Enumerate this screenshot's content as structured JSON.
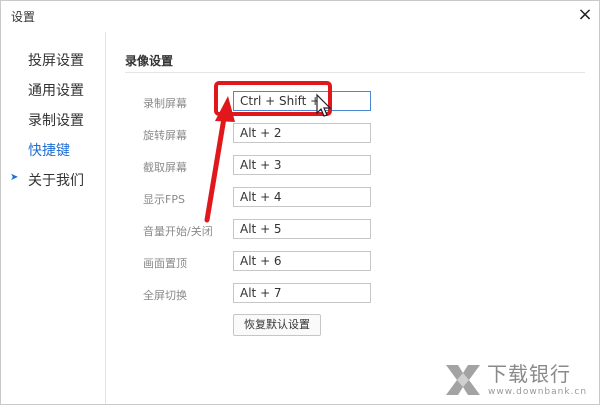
{
  "window": {
    "title": "设置",
    "close_icon": "close-icon",
    "close_glyph": "×"
  },
  "sidebar": {
    "items": [
      {
        "label": "投屏设置"
      },
      {
        "label": "通用设置"
      },
      {
        "label": "录制设置"
      },
      {
        "label": "快捷键",
        "active": true
      },
      {
        "label": "关于我们"
      }
    ],
    "marker_glyph": "➤"
  },
  "section": {
    "title": "录像设置"
  },
  "shortcuts": [
    {
      "label": "录制屏幕",
      "value": "Ctrl + Shift +"
    },
    {
      "label": "旋转屏幕",
      "value": "Alt + 2"
    },
    {
      "label": "截取屏幕",
      "value": "Alt + 3"
    },
    {
      "label": "显示FPS",
      "value": "Alt + 4"
    },
    {
      "label": "音量开始/关闭",
      "value": "Alt + 5"
    },
    {
      "label": "画面置顶",
      "value": "Alt + 6"
    },
    {
      "label": "全屏切换",
      "value": "Alt + 7"
    }
  ],
  "reset_button": {
    "label": "恢复默认设置"
  },
  "watermark": {
    "main": "下载银行",
    "sub": "www.downbank.cn"
  },
  "colors": {
    "accent": "#1f6fd6",
    "annotation": "#e0171b",
    "border": "#c6c6c6"
  }
}
